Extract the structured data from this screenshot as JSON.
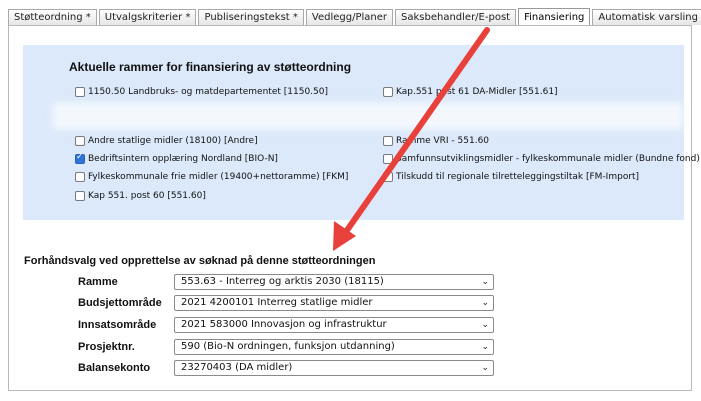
{
  "tabs": [
    {
      "label": "Støtteordning *"
    },
    {
      "label": "Utvalgskriterier *"
    },
    {
      "label": "Publiseringstekst *"
    },
    {
      "label": "Vedlegg/Planer"
    },
    {
      "label": "Saksbehandler/E-post"
    },
    {
      "label": "Finansiering",
      "active": true
    },
    {
      "label": "Automatisk varsling"
    }
  ],
  "panel": {
    "title": "Aktuelle rammer for finansiering av støtteordning",
    "left_items": [
      {
        "label": "1150.50 Landbruks- og matdepartementet [1150.50]",
        "checked": false
      },
      {
        "label": "Andre statlige midler (18100) [Andre]",
        "checked": false
      },
      {
        "label": "Bedriftsintern opplæring Nordland [BIO-N]",
        "checked": true
      },
      {
        "label": "Fylkeskommunale frie midler (19400+nettoramme) [FKM]",
        "checked": false
      },
      {
        "label": "Kap 551. post 60 [551.60]",
        "checked": false
      }
    ],
    "right_items": [
      {
        "label": "Kap.551 post 61 DA-Midler [551.61]",
        "checked": false
      },
      {
        "label": "Ramme VRI - 551.60",
        "checked": false
      },
      {
        "label": "Samfunnsutviklingsmidler - fylkeskommunale midler (Bundne fond)",
        "checked": false
      },
      {
        "label": "Tilskudd til regionale tilretteleggingstiltak [FM-Import]",
        "checked": false
      }
    ]
  },
  "preselect": {
    "title": "Forhåndsvalg ved opprettelse av søknad på denne støtteordningen",
    "fields": [
      {
        "label": "Ramme",
        "value": "553.63 - Interreg og arktis 2030 (18115)"
      },
      {
        "label": "Budsjettområde",
        "value": "2021 4200101 Interreg statlige midler"
      },
      {
        "label": "Innsatsområde",
        "value": "2021 583000 Innovasjon og infrastruktur"
      },
      {
        "label": "Prosjektnr.",
        "value": "590 (Bio-N ordningen, funksjon utdanning)"
      },
      {
        "label": "Balansekonto",
        "value": "23270403 (DA midler)"
      }
    ]
  },
  "icons": {
    "dropdown": "chevron-down-icon",
    "check": "checkmark-icon"
  },
  "colors": {
    "panel_bg": "#dce9fa",
    "arrow": "#e8403a",
    "checkbox_checked": "#2e74d6"
  }
}
